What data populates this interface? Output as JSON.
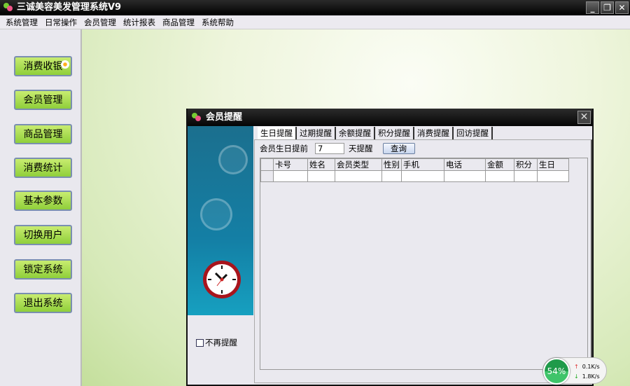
{
  "app": {
    "title": "三诚美容美发管理系统V9",
    "window_controls": [
      "minimize",
      "restore",
      "close"
    ]
  },
  "menu": [
    "系统管理",
    "日常操作",
    "会员管理",
    "统计报表",
    "商品管理",
    "系统帮助"
  ],
  "sidebar": [
    "消费收银",
    "会员管理",
    "商品管理",
    "消费统计",
    "基本参数",
    "切换用户",
    "锁定系统",
    "退出系统"
  ],
  "dialog": {
    "title": "会员提醒",
    "tabs": [
      "生日提醒",
      "过期提醒",
      "余额提醒",
      "积分提醒",
      "消费提醒",
      "回访提醒"
    ],
    "form": {
      "label": "会员生日提前",
      "days": "7",
      "suffix": "天提醒",
      "query": "查询"
    },
    "columns": [
      "卡号",
      "姓名",
      "会员类型",
      "性别",
      "手机",
      "电话",
      "金额",
      "积分",
      "生日"
    ],
    "no_remind": "不再提醒"
  },
  "network": {
    "percent": "54%",
    "up": "0.1K/s",
    "down": "1.8K/s"
  }
}
